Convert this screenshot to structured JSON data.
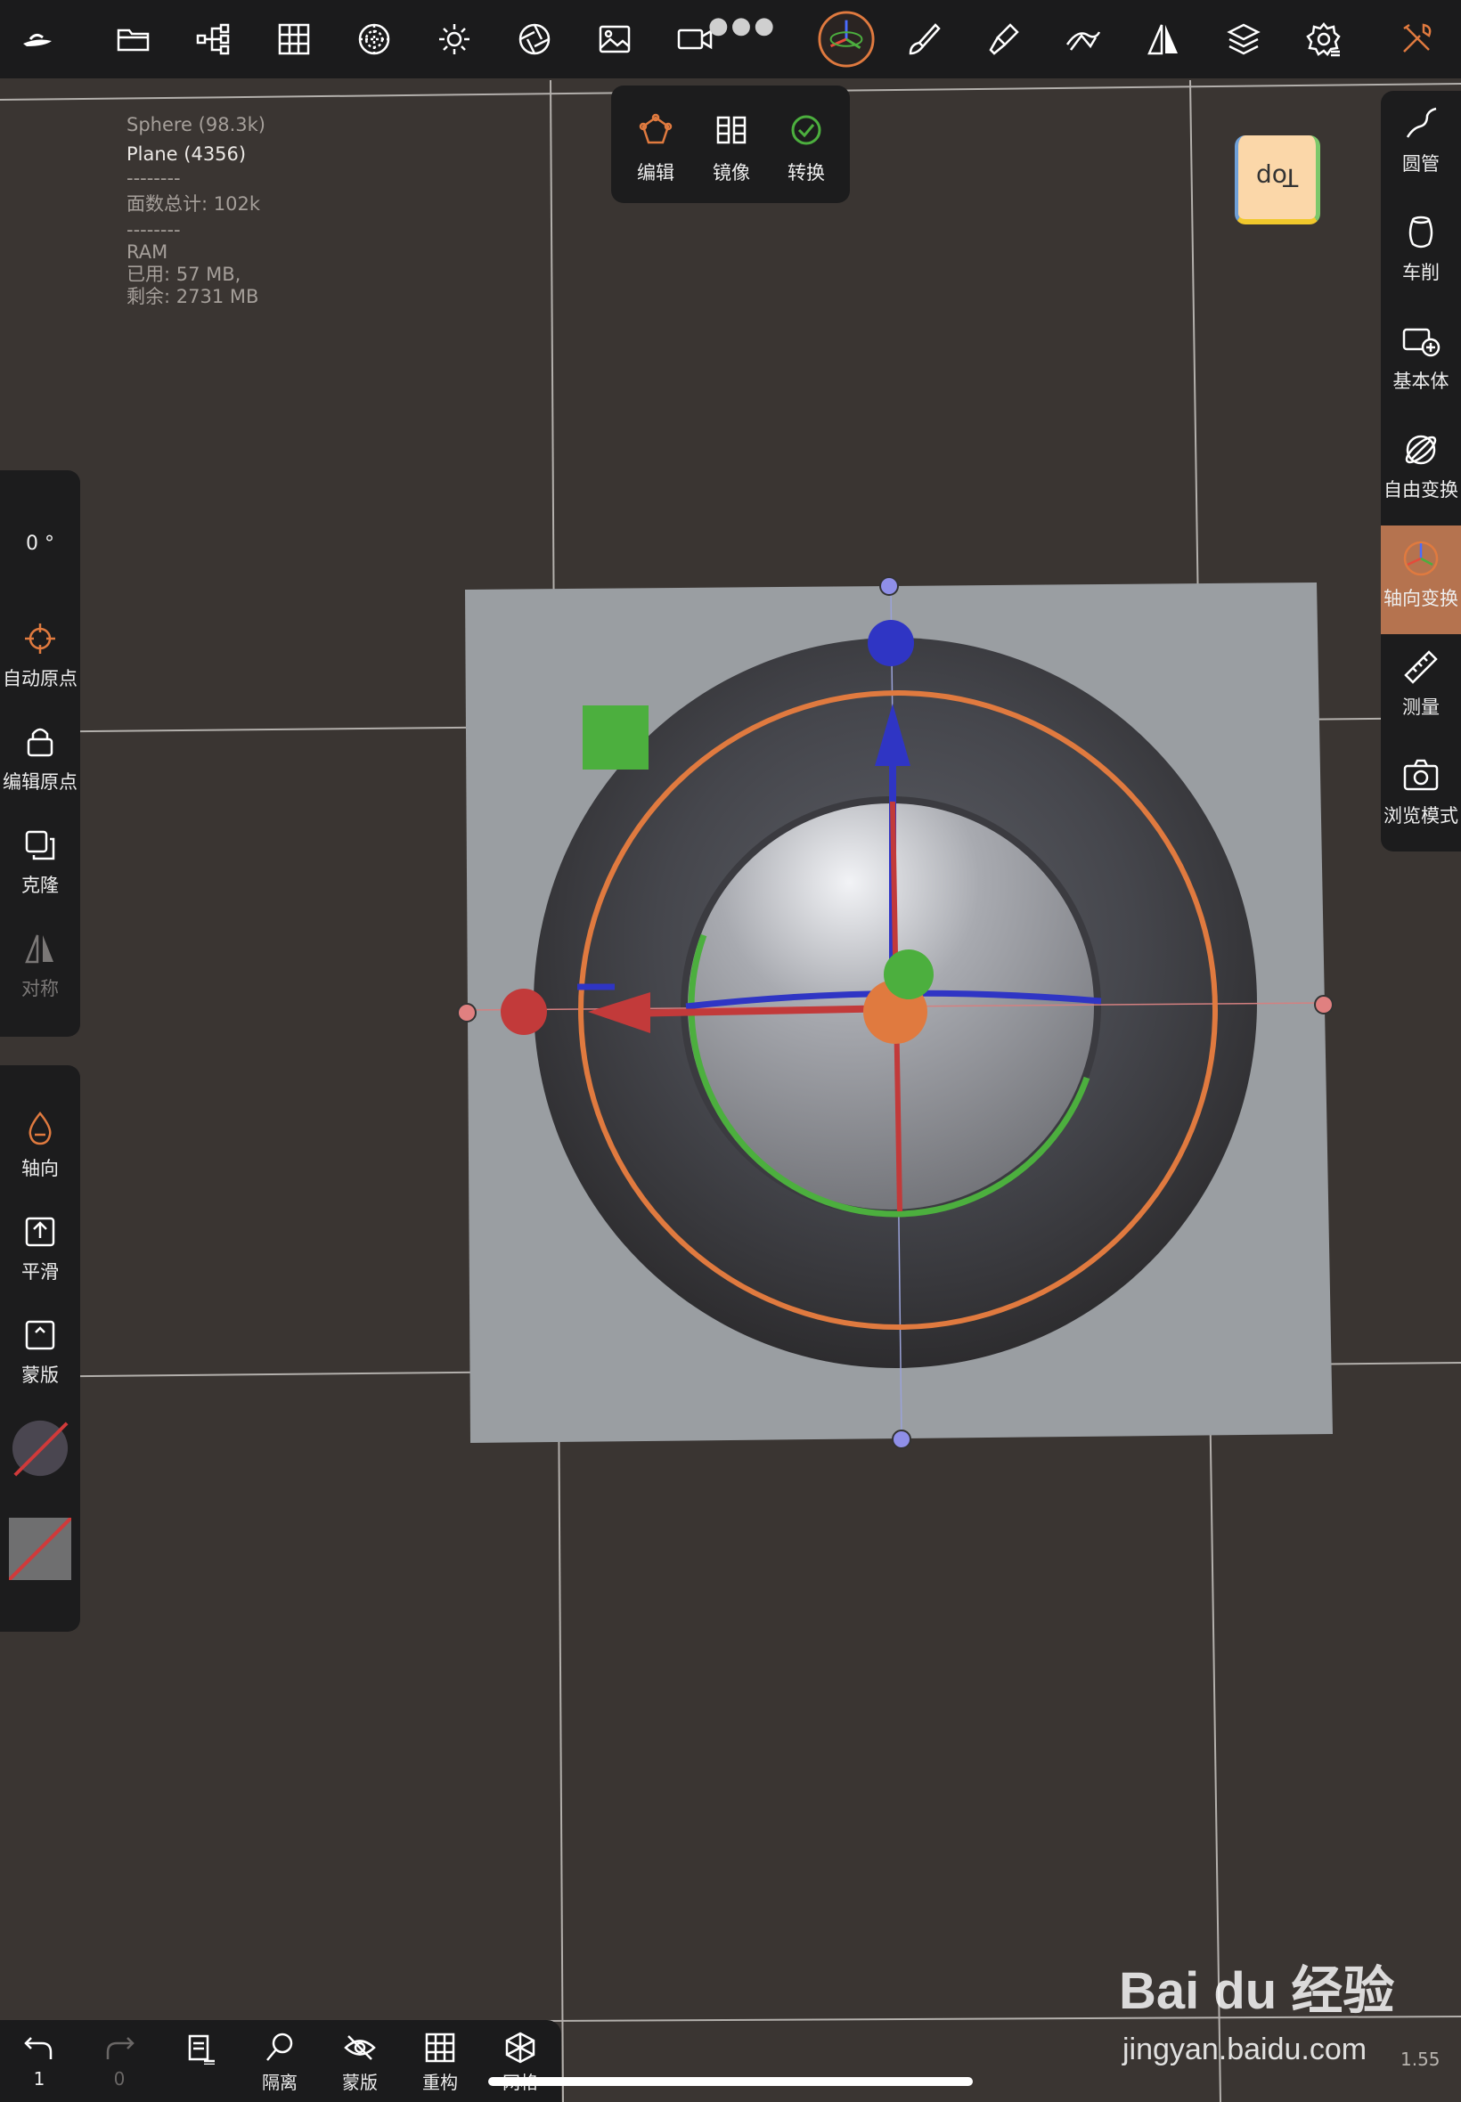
{
  "stats": {
    "sphere": "Sphere (98.3k)",
    "plane": "Plane (4356)",
    "sep1": "--------",
    "faces": "面数总计:  102k",
    "sep2": "--------",
    "ram": "RAM",
    "used": "已用:  57 MB,",
    "free": "剩余:  2731 MB"
  },
  "toolbar": {
    "icons": [
      "logo-icon",
      "folder-icon",
      "scene-tree-icon",
      "grid-icon",
      "material-sphere-icon",
      "sun-icon",
      "aperture-icon",
      "image-icon",
      "video-camera-icon",
      "gizmo-icon",
      "brush-icon",
      "paint-bucket-icon",
      "topology-icon",
      "symmetry-icon",
      "layers-icon",
      "settings-icon",
      "tools-icon"
    ]
  },
  "popup": {
    "items": [
      {
        "label": "编辑",
        "icon": "edit-icon"
      },
      {
        "label": "镜像",
        "icon": "mirror-icon"
      },
      {
        "label": "转换",
        "icon": "check-icon"
      }
    ]
  },
  "cube": {
    "label": "Top"
  },
  "right_panel": {
    "items": [
      {
        "label": "圆管",
        "icon": "tube-icon"
      },
      {
        "label": "车削",
        "icon": "lathe-icon"
      },
      {
        "label": "基本体",
        "icon": "primitive-icon"
      },
      {
        "label": "自由变换",
        "icon": "free-transform-icon"
      },
      {
        "label": "轴向变换",
        "icon": "axis-transform-icon",
        "active": true
      },
      {
        "label": "测量",
        "icon": "ruler-icon"
      },
      {
        "label": "浏览模式",
        "icon": "camera-icon"
      }
    ]
  },
  "left_panel_1": {
    "angle": "0 °",
    "items": [
      {
        "label": "自动原点",
        "icon": "crosshair-icon"
      },
      {
        "label": "编辑原点",
        "icon": "lock-icon"
      },
      {
        "label": "克隆",
        "icon": "clone-icon"
      },
      {
        "label": "对称",
        "icon": "symmetry-icon",
        "disabled": true
      }
    ]
  },
  "left_panel_2": {
    "items": [
      {
        "label": "轴向",
        "icon": "drop-icon"
      },
      {
        "label": "平滑",
        "icon": "smooth-icon"
      },
      {
        "label": "蒙版",
        "icon": "mask-icon"
      }
    ]
  },
  "bottom_bar": {
    "items": [
      {
        "label": "1",
        "icon": "undo-icon"
      },
      {
        "label": "0",
        "icon": "redo-icon"
      },
      {
        "label": "",
        "icon": "book-icon"
      },
      {
        "label": "隔离",
        "icon": "isolate-icon"
      },
      {
        "label": "蒙版",
        "icon": "hide-icon"
      },
      {
        "label": "重构",
        "icon": "remesh-icon"
      },
      {
        "label": "网格",
        "icon": "wireframe-icon"
      }
    ]
  },
  "zoom": "1.55",
  "watermark": {
    "brand": "Bai du 经验",
    "url": "jingyan.baidu.com"
  },
  "colors": {
    "accent": "#e07a3f",
    "x_axis": "#c23a3a",
    "y_axis": "#4caf3e",
    "z_axis": "#2f35c4",
    "background": "#3a3532",
    "panel": "#1c1c1d"
  }
}
